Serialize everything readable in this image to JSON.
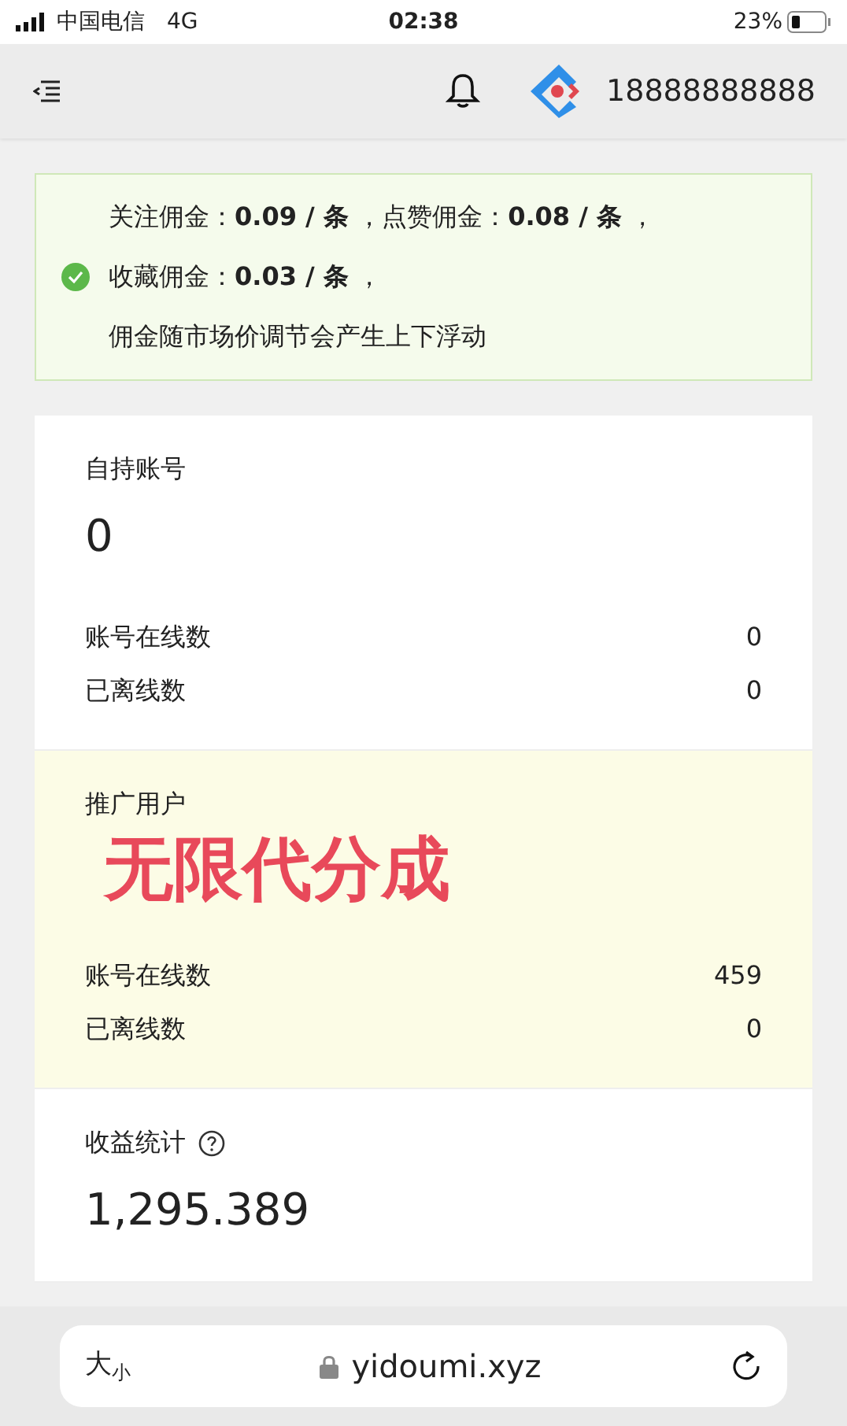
{
  "status_bar": {
    "carrier": "中国电信",
    "network": "4G",
    "time": "02:38",
    "battery": "23%"
  },
  "header": {
    "phone": "18888888888"
  },
  "notice": {
    "lines": [
      "关注佣金：**0.09 / 条** ，点赞佣金：**0.08 / 条** ，",
      "收藏佣金：**0.03 / 条** ，",
      "佣金随市场价调节会产生上下浮动"
    ]
  },
  "sections": [
    {
      "kind": "plain",
      "title": "自持账号",
      "value": "0",
      "rows": [
        {
          "label": "账号在线数",
          "value": "0"
        },
        {
          "label": "已离线数",
          "value": "0"
        }
      ]
    },
    {
      "kind": "highlight",
      "title": "推广用户",
      "promo": "无限代分成",
      "rows": [
        {
          "label": "账号在线数",
          "value": "459"
        },
        {
          "label": "已离线数",
          "value": "0"
        }
      ]
    },
    {
      "kind": "help",
      "title": "收益统计",
      "value": "1,295.389"
    }
  ],
  "browser_bar": {
    "text_size_large": "大",
    "text_size_small": "小",
    "address": "yidoumi.xyz"
  }
}
